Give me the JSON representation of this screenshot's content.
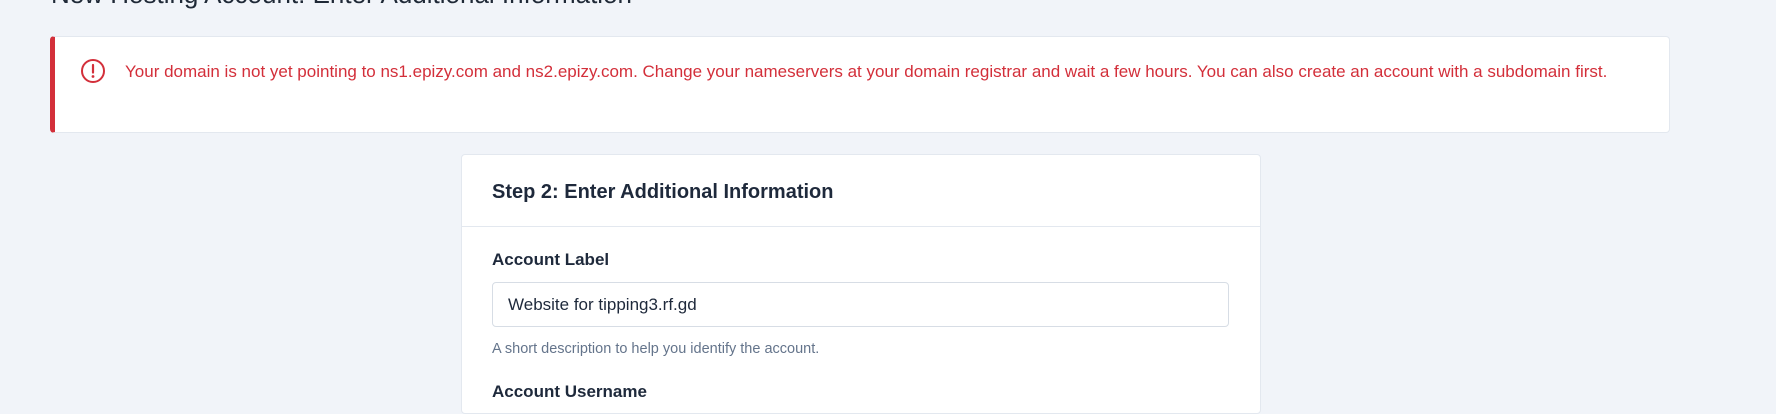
{
  "page": {
    "title": "New Hosting Account: Enter Additional Information"
  },
  "alert": {
    "icon": "exclamation-circle-icon",
    "color": "#d32f3a",
    "message": "Your domain is not yet pointing to ns1.epizy.com and ns2.epizy.com. Change your nameservers at your domain registrar and wait a few hours. You can also create an account with a subdomain first."
  },
  "step_card": {
    "title": "Step 2: Enter Additional Information",
    "account_label": {
      "label": "Account Label",
      "value": "Website for tipping3.rf.gd",
      "help": "A short description to help you identify the account."
    },
    "account_username": {
      "label": "Account Username"
    }
  }
}
